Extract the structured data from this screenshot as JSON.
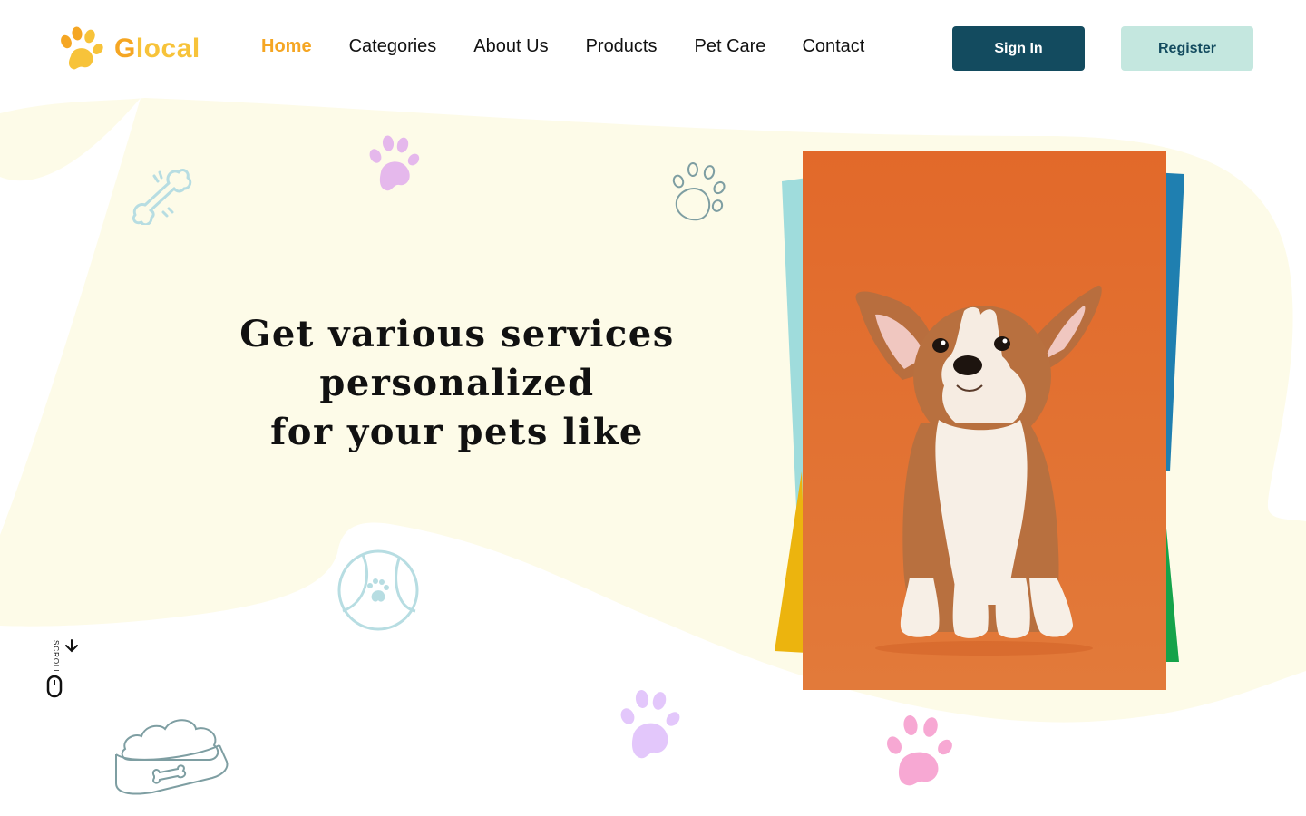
{
  "brand": {
    "name_first": "G",
    "name_rest": "local",
    "icon": "paw-logo-icon"
  },
  "nav": {
    "items": [
      {
        "label": "Home",
        "active": true
      },
      {
        "label": "Categories",
        "active": false
      },
      {
        "label": "About Us",
        "active": false
      },
      {
        "label": "Products",
        "active": false
      },
      {
        "label": "Pet Care",
        "active": false
      },
      {
        "label": "Contact",
        "active": false
      }
    ]
  },
  "auth": {
    "signin_label": "Sign In",
    "register_label": "Register"
  },
  "hero": {
    "title_line1": "Get various services personalized",
    "title_line2": "for your pets like",
    "image": "corgi-puppy-photo"
  },
  "scroll": {
    "label": "SCROLL",
    "icon": "mouse-scroll-icon"
  },
  "decorations": [
    "bone-icon",
    "paw-print-icon",
    "paw-outline-icon",
    "ball-icon",
    "food-bowl-icon"
  ],
  "colors": {
    "accent": "#f5a623",
    "primary": "#134b5f",
    "secondary": "#c4e7df",
    "blob": "#fdfbe8",
    "photo_bg": "#e2692a"
  }
}
